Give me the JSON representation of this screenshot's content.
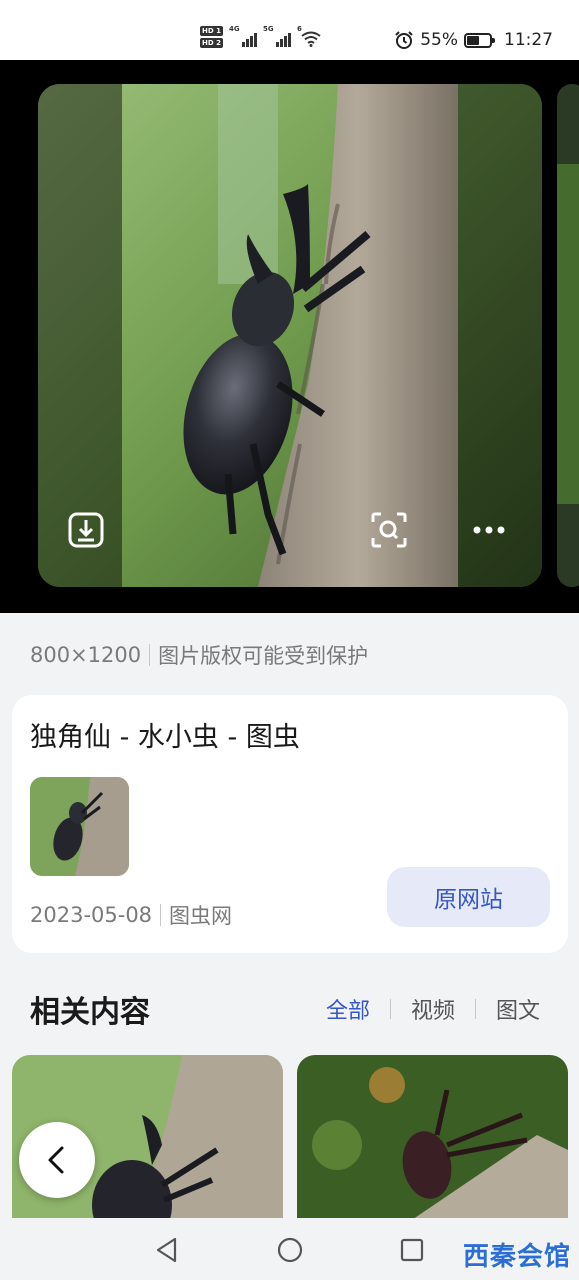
{
  "status_bar": {
    "hd1": "HD 1",
    "hd2": "HD 2",
    "sim1_type": "4G",
    "sim2_type": "5G",
    "wifi_type": "6",
    "battery_percent": "55%",
    "battery_level": 0.55,
    "time": "11:27"
  },
  "image": {
    "dimensions": "800×1200",
    "copyright_note": "图片版权可能受到保护",
    "download_icon": "download-icon",
    "lens_icon": "visual-search-icon",
    "more_icon": "more-dots-icon"
  },
  "source": {
    "title": "独角仙 - 水小虫 - 图虫",
    "date": "2023-05-08",
    "site": "图虫网",
    "button_label": "原网站"
  },
  "related": {
    "title": "相关内容",
    "tabs": [
      {
        "label": "全部",
        "active": true
      },
      {
        "label": "视频",
        "active": false
      },
      {
        "label": "图文",
        "active": false
      }
    ]
  },
  "navbar": {
    "back": "triangle-back-icon",
    "home": "circle-home-icon",
    "recents": "square-recents-icon"
  },
  "watermark": "西秦会馆",
  "colors": {
    "accent": "#3457c9",
    "button_bg": "#e6eaf8",
    "page_bg": "#f2f3f5"
  }
}
